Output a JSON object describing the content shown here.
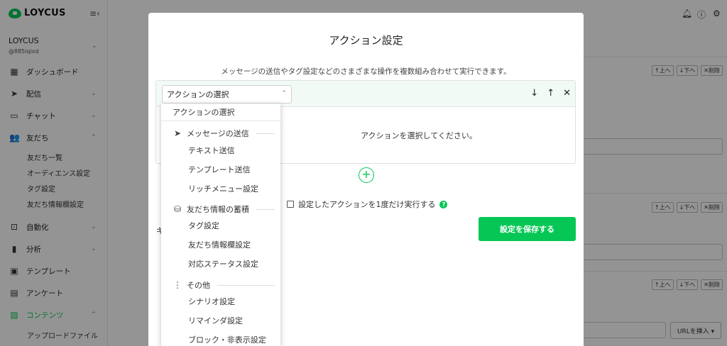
{
  "brand": {
    "name": "LOYCUS"
  },
  "account": {
    "name": "LOYCUS",
    "id": "@885iqixd"
  },
  "sidebar": {
    "items": [
      {
        "label": "ダッシュボード",
        "icon": "grid-icon"
      },
      {
        "label": "配信",
        "icon": "send-icon"
      },
      {
        "label": "チャット",
        "icon": "chat-icon"
      },
      {
        "label": "友だち",
        "icon": "users-icon"
      },
      {
        "label": "自動化",
        "icon": "robot-icon"
      },
      {
        "label": "分析",
        "icon": "bar-chart-icon"
      },
      {
        "label": "テンプレート",
        "icon": "template-icon"
      },
      {
        "label": "アンケート",
        "icon": "survey-icon"
      },
      {
        "label": "コンテンツ",
        "icon": "image-icon"
      }
    ],
    "friends_sub": [
      "友だち一覧",
      "オーディエンス設定",
      "タグ設定",
      "友だち情報欄設定"
    ],
    "contents_sub": [
      "アップロードファイル"
    ]
  },
  "background": {
    "up": "↑上へ",
    "down": "↓下へ",
    "delete": "✕削除",
    "url_insert": "URLを挿入 ▾"
  },
  "modal": {
    "title": "アクション設定",
    "description": "メッセージの送信やタグ設定などのさまざまな操作を複数組み合わせて実行できます。",
    "select_value": "アクションの選択",
    "empty_message": "アクションを選択してください。",
    "once_label": "設定したアクションを1度だけ実行する",
    "save_label": "設定を保存する",
    "ki": "キ"
  },
  "dropdown": {
    "first": "アクションの選択",
    "groups": [
      {
        "label": "メッセージの送信",
        "icon": "send-icon",
        "options": [
          "テキスト送信",
          "テンプレート送信",
          "リッチメニュー設定"
        ]
      },
      {
        "label": "友だち情報の蓄積",
        "icon": "database-icon",
        "options": [
          "タグ設定",
          "友だち情報欄設定",
          "対応ステータス設定"
        ]
      },
      {
        "label": "その他",
        "icon": "more-vertical-icon",
        "options": [
          "シナリオ設定",
          "リマインダ設定",
          "ブロック・非表示設定"
        ]
      }
    ]
  },
  "colors": {
    "accent": "#06c755",
    "overlay": "rgba(0,0,0,0.42)"
  }
}
